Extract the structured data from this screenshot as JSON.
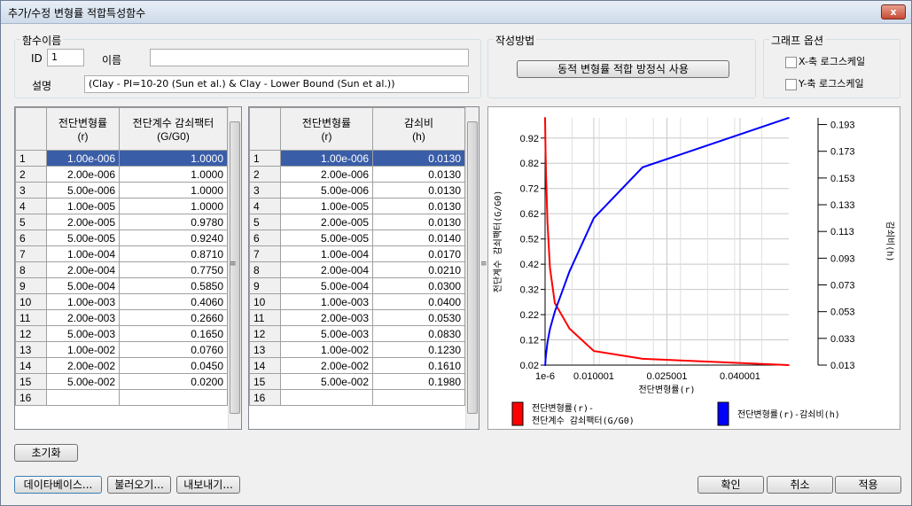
{
  "window": {
    "title": "추가/수정 변형률 적합특성함수",
    "close": "x"
  },
  "function_name": {
    "group_label": "함수이름",
    "id_label": "ID",
    "id_value": "1",
    "name_label": "이름",
    "name_value": "",
    "desc_label": "설명",
    "desc_value": "(Clay - PI=10-20 (Sun et al.) & Clay - Lower Bound (Sun et al.))"
  },
  "method": {
    "group_label": "작성방법",
    "button": "동적 변형률 적합 방정식 사용"
  },
  "graph_options": {
    "group_label": "그래프 옵션",
    "x_log": "X-축 로그스케일",
    "y_log": "Y-축 로그스케일"
  },
  "table1": {
    "col1": "전단변형률",
    "col1_sub": "(r)",
    "col2": "전단계수 감쇠팩터",
    "col2_sub": "(G/G0)",
    "rows": [
      [
        "1",
        "1.00e-006",
        "1.0000"
      ],
      [
        "2",
        "2.00e-006",
        "1.0000"
      ],
      [
        "3",
        "5.00e-006",
        "1.0000"
      ],
      [
        "4",
        "1.00e-005",
        "1.0000"
      ],
      [
        "5",
        "2.00e-005",
        "0.9780"
      ],
      [
        "6",
        "5.00e-005",
        "0.9240"
      ],
      [
        "7",
        "1.00e-004",
        "0.8710"
      ],
      [
        "8",
        "2.00e-004",
        "0.7750"
      ],
      [
        "9",
        "5.00e-004",
        "0.5850"
      ],
      [
        "10",
        "1.00e-003",
        "0.4060"
      ],
      [
        "11",
        "2.00e-003",
        "0.2660"
      ],
      [
        "12",
        "5.00e-003",
        "0.1650"
      ],
      [
        "13",
        "1.00e-002",
        "0.0760"
      ],
      [
        "14",
        "2.00e-002",
        "0.0450"
      ],
      [
        "15",
        "5.00e-002",
        "0.0200"
      ],
      [
        "16",
        "",
        ""
      ]
    ]
  },
  "table2": {
    "col1": "전단변형률",
    "col1_sub": "(r)",
    "col2": "감쇠비",
    "col2_sub": "(h)",
    "rows": [
      [
        "1",
        "1.00e-006",
        "0.0130"
      ],
      [
        "2",
        "2.00e-006",
        "0.0130"
      ],
      [
        "3",
        "5.00e-006",
        "0.0130"
      ],
      [
        "4",
        "1.00e-005",
        "0.0130"
      ],
      [
        "5",
        "2.00e-005",
        "0.0130"
      ],
      [
        "6",
        "5.00e-005",
        "0.0140"
      ],
      [
        "7",
        "1.00e-004",
        "0.0170"
      ],
      [
        "8",
        "2.00e-004",
        "0.0210"
      ],
      [
        "9",
        "5.00e-004",
        "0.0300"
      ],
      [
        "10",
        "1.00e-003",
        "0.0400"
      ],
      [
        "11",
        "2.00e-003",
        "0.0530"
      ],
      [
        "12",
        "5.00e-003",
        "0.0830"
      ],
      [
        "13",
        "1.00e-002",
        "0.1230"
      ],
      [
        "14",
        "2.00e-002",
        "0.1610"
      ],
      [
        "15",
        "5.00e-002",
        "0.1980"
      ],
      [
        "16",
        "",
        ""
      ]
    ]
  },
  "chart_data": {
    "type": "line",
    "xlabel": "전단변형률(r)",
    "ylabel_left": "전단계수 감쇠팩터(G/G0)",
    "ylabel_right": "감쇠비(h)",
    "xlim": [
      1e-06,
      0.05
    ],
    "ylim_left": [
      0.02,
      1.0
    ],
    "ylim_right": [
      0.013,
      0.198
    ],
    "x_ticks": [
      "1e-6",
      "0.010001",
      "0.025001",
      "0.040001"
    ],
    "x_tick_values": [
      1e-06,
      0.010001,
      0.025001,
      0.040001
    ],
    "y_ticks_left": [
      "0.02",
      "0.12",
      "0.22",
      "0.32",
      "0.42",
      "0.52",
      "0.62",
      "0.72",
      "0.82",
      "0.92"
    ],
    "y_ticks_right": [
      "0.013",
      "0.033",
      "0.053",
      "0.073",
      "0.093",
      "0.113",
      "0.133",
      "0.153",
      "0.173",
      "0.193"
    ],
    "grid": true,
    "series": [
      {
        "name": "전단변형률(r)-전단계수 감쇠팩터(G/G0)",
        "color": "#ff0000",
        "axis": "left",
        "x": [
          1e-06,
          2e-06,
          5e-06,
          1e-05,
          2e-05,
          5e-05,
          0.0001,
          0.0002,
          0.0005,
          0.001,
          0.002,
          0.005,
          0.01,
          0.02,
          0.05
        ],
        "y": [
          1.0,
          1.0,
          1.0,
          1.0,
          0.978,
          0.924,
          0.871,
          0.775,
          0.585,
          0.406,
          0.266,
          0.165,
          0.076,
          0.045,
          0.02
        ]
      },
      {
        "name": "전단변형률(r)-감쇠비(h)",
        "color": "#0000ff",
        "axis": "right",
        "x": [
          1e-06,
          2e-06,
          5e-06,
          1e-05,
          2e-05,
          5e-05,
          0.0001,
          0.0002,
          0.0005,
          0.001,
          0.002,
          0.005,
          0.01,
          0.02,
          0.05
        ],
        "y": [
          0.013,
          0.013,
          0.013,
          0.013,
          0.013,
          0.014,
          0.017,
          0.021,
          0.03,
          0.04,
          0.053,
          0.083,
          0.123,
          0.161,
          0.198
        ]
      }
    ],
    "legend": [
      {
        "line1": "전단변형률(r)-",
        "line2": "전단계수 감쇠팩터(G/G0)",
        "color": "#ff0000"
      },
      {
        "line1": "전단변형률(r)-감쇠비(h)",
        "line2": "",
        "color": "#0000ff"
      }
    ]
  },
  "buttons": {
    "reset": "초기화",
    "database": "데이타베이스...",
    "load": "불러오기...",
    "export": "내보내기...",
    "ok": "확인",
    "cancel": "취소",
    "apply": "적용"
  }
}
